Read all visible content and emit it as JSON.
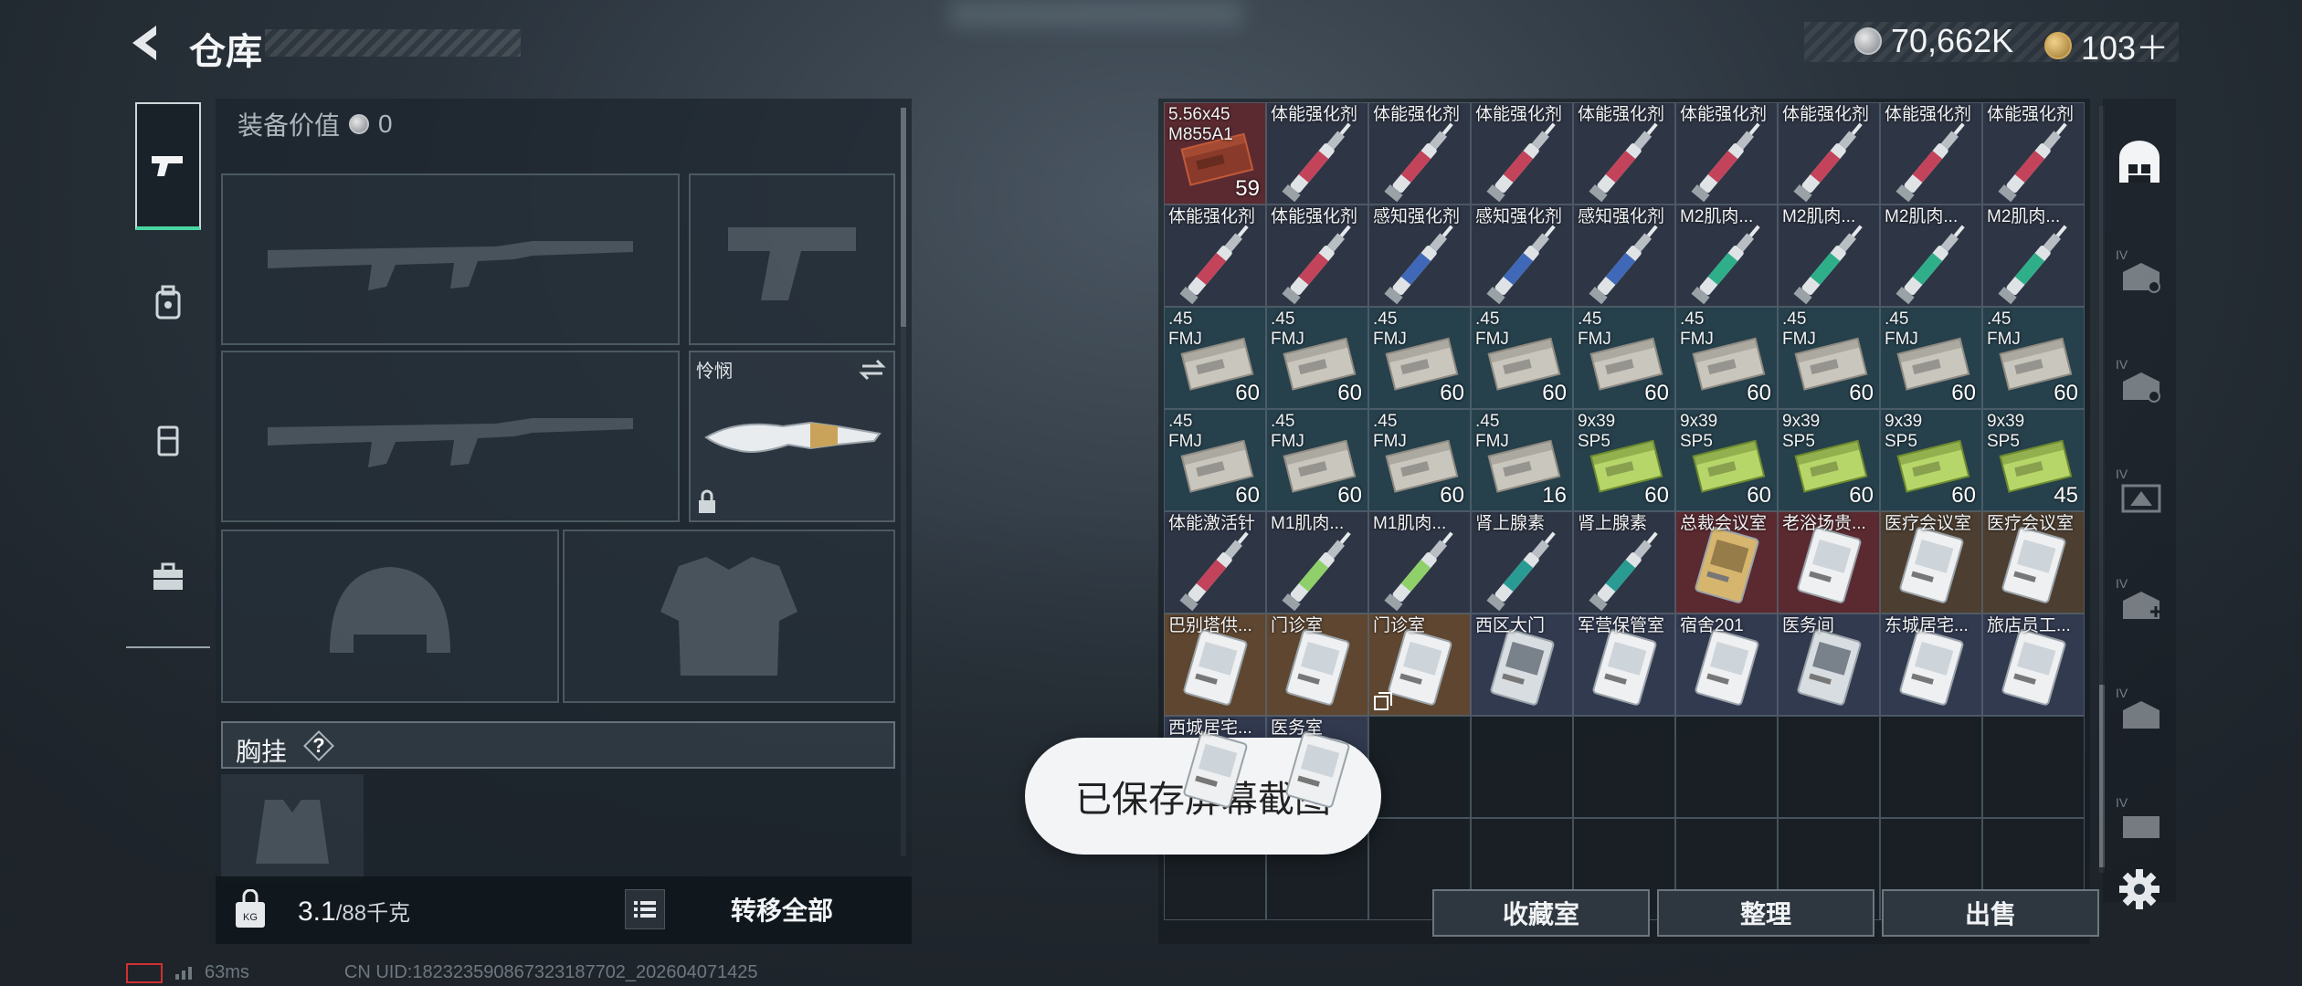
{
  "header": {
    "title": "仓库"
  },
  "currency": {
    "silver_amount": "70,662K",
    "gold_amount": "103＋",
    "sub_label": ""
  },
  "side_tabs": [
    {
      "name": "pistol"
    },
    {
      "name": "backpack-equip"
    },
    {
      "name": "pouch"
    },
    {
      "name": "toolbox"
    }
  ],
  "equipment": {
    "value_label": "装备价值",
    "value": "0",
    "knife_name": "怜悯",
    "chest_label": "胸挂",
    "help_symbol": "?",
    "weight": "3.1",
    "weight_max": "/88千克",
    "transfer_label": "转移全部"
  },
  "storage": {
    "rows": [
      [
        {
          "name": "5.56x45\nM855A1",
          "count": "59",
          "color": "c-red",
          "art": "ammo-red"
        },
        {
          "name": "体能强化剂",
          "count": "",
          "color": "c-dark",
          "art": "syringe-red"
        },
        {
          "name": "体能强化剂",
          "count": "",
          "color": "c-dark",
          "art": "syringe-red"
        },
        {
          "name": "体能强化剂",
          "count": "",
          "color": "c-dark",
          "art": "syringe-red"
        },
        {
          "name": "体能强化剂",
          "count": "",
          "color": "c-dark",
          "art": "syringe-red"
        },
        {
          "name": "体能强化剂",
          "count": "",
          "color": "c-dark",
          "art": "syringe-red"
        },
        {
          "name": "体能强化剂",
          "count": "",
          "color": "c-dark",
          "art": "syringe-red"
        },
        {
          "name": "体能强化剂",
          "count": "",
          "color": "c-dark",
          "art": "syringe-red"
        },
        {
          "name": "体能强化剂",
          "count": "",
          "color": "c-dark",
          "art": "syringe-red"
        }
      ],
      [
        {
          "name": "体能强化剂",
          "count": "",
          "color": "c-dark",
          "art": "syringe-red"
        },
        {
          "name": "体能强化剂",
          "count": "",
          "color": "c-dark",
          "art": "syringe-red"
        },
        {
          "name": "感知强化剂",
          "count": "",
          "color": "c-dark",
          "art": "syringe-blue"
        },
        {
          "name": "感知强化剂",
          "count": "",
          "color": "c-dark",
          "art": "syringe-blue"
        },
        {
          "name": "感知强化剂",
          "count": "",
          "color": "c-dark",
          "art": "syringe-blue"
        },
        {
          "name": "M2肌肉...",
          "count": "",
          "color": "c-dark",
          "art": "syringe-green"
        },
        {
          "name": "M2肌肉...",
          "count": "",
          "color": "c-dark",
          "art": "syringe-green"
        },
        {
          "name": "M2肌肉...",
          "count": "",
          "color": "c-dark",
          "art": "syringe-green"
        },
        {
          "name": "M2肌肉...",
          "count": "",
          "color": "c-dark",
          "art": "syringe-green"
        }
      ],
      [
        {
          "name": ".45\nFMJ",
          "count": "60",
          "color": "c-teal",
          "art": "ammo-box"
        },
        {
          "name": ".45\nFMJ",
          "count": "60",
          "color": "c-teal",
          "art": "ammo-box"
        },
        {
          "name": ".45\nFMJ",
          "count": "60",
          "color": "c-teal",
          "art": "ammo-box"
        },
        {
          "name": ".45\nFMJ",
          "count": "60",
          "color": "c-teal",
          "art": "ammo-box"
        },
        {
          "name": ".45\nFMJ",
          "count": "60",
          "color": "c-teal",
          "art": "ammo-box"
        },
        {
          "name": ".45\nFMJ",
          "count": "60",
          "color": "c-teal",
          "art": "ammo-box"
        },
        {
          "name": ".45\nFMJ",
          "count": "60",
          "color": "c-teal",
          "art": "ammo-box"
        },
        {
          "name": ".45\nFMJ",
          "count": "60",
          "color": "c-teal",
          "art": "ammo-box"
        },
        {
          "name": ".45\nFMJ",
          "count": "60",
          "color": "c-teal",
          "art": "ammo-box"
        }
      ],
      [
        {
          "name": ".45\nFMJ",
          "count": "60",
          "color": "c-teal",
          "art": "ammo-box"
        },
        {
          "name": ".45\nFMJ",
          "count": "60",
          "color": "c-teal",
          "art": "ammo-box"
        },
        {
          "name": ".45\nFMJ",
          "count": "60",
          "color": "c-teal",
          "art": "ammo-box"
        },
        {
          "name": ".45\nFMJ",
          "count": "16",
          "color": "c-teal",
          "art": "ammo-box"
        },
        {
          "name": "9x39\nSP5",
          "count": "60",
          "color": "c-teal",
          "art": "ammo-green"
        },
        {
          "name": "9x39\nSP5",
          "count": "60",
          "color": "c-teal",
          "art": "ammo-green"
        },
        {
          "name": "9x39\nSP5",
          "count": "60",
          "color": "c-teal",
          "art": "ammo-green"
        },
        {
          "name": "9x39\nSP5",
          "count": "60",
          "color": "c-teal",
          "art": "ammo-green"
        },
        {
          "name": "9x39\nSP5",
          "count": "45",
          "color": "c-teal",
          "art": "ammo-green"
        }
      ],
      [
        {
          "name": "体能激活针",
          "count": "",
          "color": "c-dark",
          "art": "syringe-red"
        },
        {
          "name": "M1肌肉...",
          "count": "",
          "color": "c-dark",
          "art": "syringe-lime"
        },
        {
          "name": "M1肌肉...",
          "count": "",
          "color": "c-dark",
          "art": "syringe-lime"
        },
        {
          "name": "肾上腺素",
          "count": "",
          "color": "c-dark",
          "art": "syringe-teal"
        },
        {
          "name": "肾上腺素",
          "count": "",
          "color": "c-dark",
          "art": "syringe-teal"
        },
        {
          "name": "总裁会议室",
          "count": "",
          "color": "c-red",
          "art": "keycard-gold"
        },
        {
          "name": "老浴场贵...",
          "count": "",
          "color": "c-red",
          "art": "keycard"
        },
        {
          "name": "医疗会议室",
          "count": "",
          "color": "c-gold",
          "art": "keycard"
        },
        {
          "name": "医疗会议室",
          "count": "",
          "color": "c-gold",
          "art": "keycard"
        }
      ],
      [
        {
          "name": "巴别塔供...",
          "count": "",
          "color": "c-brown",
          "art": "keycard"
        },
        {
          "name": "门诊室",
          "count": "",
          "color": "c-brown",
          "art": "keycard"
        },
        {
          "name": "门诊室",
          "count": "",
          "color": "c-brown",
          "art": "keycard",
          "locked": true
        },
        {
          "name": "西区大门",
          "count": "",
          "color": "c-blue",
          "art": "keycard-dark"
        },
        {
          "name": "军营保管室",
          "count": "",
          "color": "c-blue",
          "art": "keycard"
        },
        {
          "name": "宿舍201",
          "count": "",
          "color": "c-blue",
          "art": "keycard"
        },
        {
          "name": "医务间",
          "count": "",
          "color": "c-blue",
          "art": "keycard-dark"
        },
        {
          "name": "东城居宅...",
          "count": "",
          "color": "c-blue",
          "art": "keycard"
        },
        {
          "name": "旅店员工...",
          "count": "",
          "color": "c-blue",
          "art": "keycard"
        }
      ],
      [
        {
          "name": "西城居宅...",
          "count": "",
          "color": "c-blue",
          "art": "keycard"
        },
        {
          "name": "医务室",
          "count": "",
          "color": "c-blue",
          "art": "keycard"
        },
        null,
        null,
        null,
        null,
        null,
        null,
        null
      ],
      [
        null,
        null,
        null,
        null,
        null,
        null,
        null,
        null,
        null
      ]
    ],
    "buttons": {
      "collection": "收藏室",
      "organize": "整理",
      "sell": "出售"
    }
  },
  "toast": "已保存屏幕截图",
  "status": {
    "ping": "63ms",
    "uid": "CN UID:1823235908673231877​02_202604071425"
  }
}
